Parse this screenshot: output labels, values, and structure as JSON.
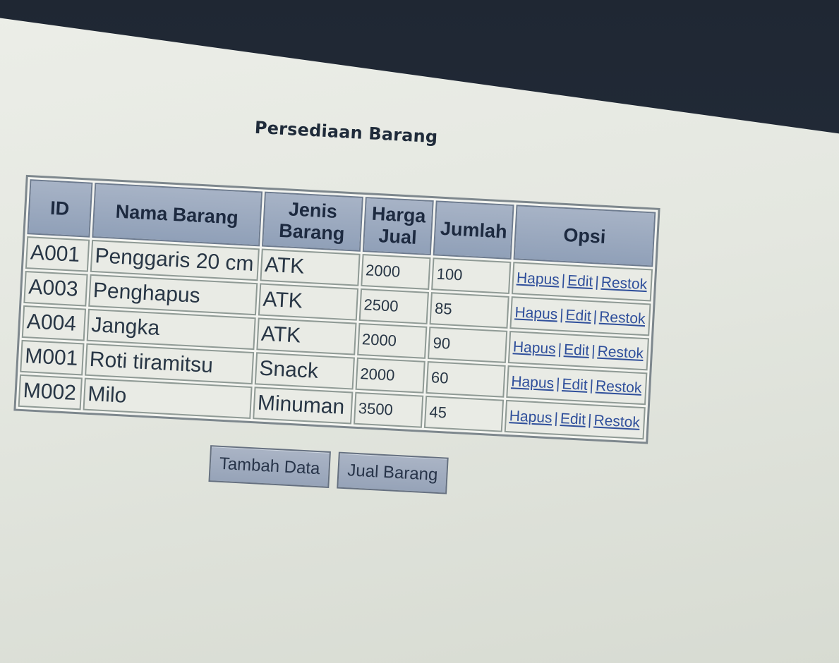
{
  "page": {
    "title": "Persediaan Barang"
  },
  "table": {
    "headers": [
      "ID",
      "Nama Barang",
      "Jenis Barang",
      "Harga Jual",
      "Jumlah",
      "Opsi"
    ],
    "rows": [
      {
        "id": "A001",
        "nama": "Penggaris 20 cm",
        "jenis": "ATK",
        "harga": "2000",
        "jumlah": "100"
      },
      {
        "id": "A003",
        "nama": "Penghapus",
        "jenis": "ATK",
        "harga": "2500",
        "jumlah": "85"
      },
      {
        "id": "A004",
        "nama": "Jangka",
        "jenis": "ATK",
        "harga": "2000",
        "jumlah": "90"
      },
      {
        "id": "M001",
        "nama": "Roti tiramitsu",
        "jenis": "Snack",
        "harga": "2000",
        "jumlah": "60"
      },
      {
        "id": "M002",
        "nama": "Milo",
        "jenis": "Minuman",
        "harga": "3500",
        "jumlah": "45"
      }
    ],
    "actions": {
      "hapus": "Hapus",
      "edit": "Edit",
      "restok": "Restok",
      "separator": "|"
    }
  },
  "buttons": {
    "tambah_data": "Tambah Data",
    "jual_barang": "Jual Barang"
  }
}
